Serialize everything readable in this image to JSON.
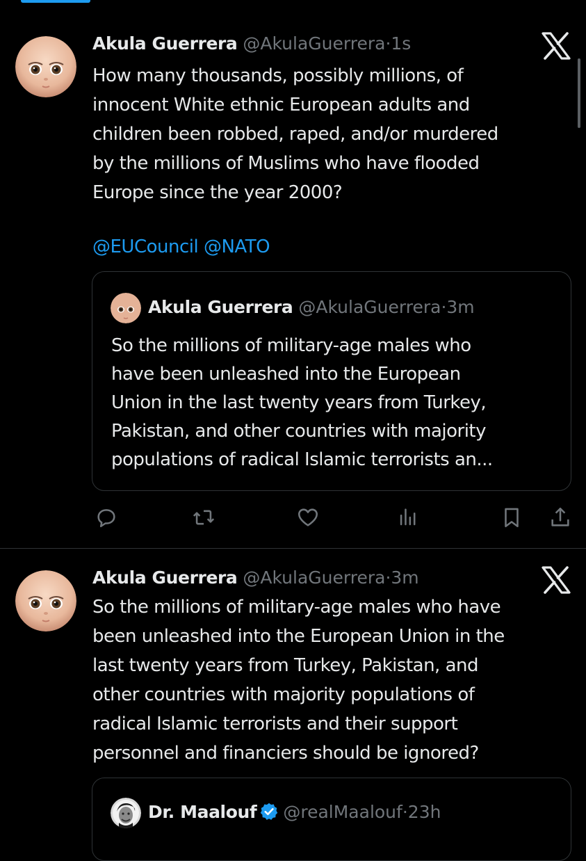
{
  "tweets": [
    {
      "author_name": "Akula Guerrera",
      "handle": "@AkulaGuerrera",
      "separator": "·",
      "time": "1s",
      "body_lines": [
        "How many thousands, possibly millions, of",
        "innocent White ethnic European adults and",
        "children been robbed, raped, and/or murdered",
        "by the millions of Muslims who have flooded",
        "Europe since the year 2000?"
      ],
      "mentions": "@EUCouncil @NATO",
      "quote": {
        "author_name": "Akula Guerrera",
        "handle": "@AkulaGuerrera",
        "separator": "·",
        "time": "3m",
        "body_lines": [
          "So the millions of military-age males who",
          "have been unleashed into the European",
          "Union in the last twenty years from Turkey,",
          "Pakistan, and other countries with majority",
          "populations of radical Islamic terrorists an..."
        ]
      }
    },
    {
      "author_name": "Akula Guerrera",
      "handle": "@AkulaGuerrera",
      "separator": "·",
      "time": "3m",
      "body_lines": [
        "So the millions of military-age males who have",
        "been unleashed into the European Union in the",
        "last twenty years from Turkey, Pakistan, and",
        "other countries with majority populations of",
        "radical Islamic terrorists and their support",
        "personnel and financiers should be ignored?"
      ],
      "quote": {
        "author_name": "Dr. Maalouf",
        "handle": "@realMaalouf",
        "separator": "·",
        "time": "23h"
      }
    }
  ],
  "actions": [
    "reply-icon",
    "repost-icon",
    "like-icon",
    "views-icon",
    "bookmark-icon",
    "share-icon"
  ],
  "colors": {
    "background": "#000000",
    "text_primary": "#e7e9ea",
    "text_secondary": "#71767b",
    "link": "#1d9bf0",
    "border": "#2f3336",
    "verified": "#1d9bf0"
  }
}
